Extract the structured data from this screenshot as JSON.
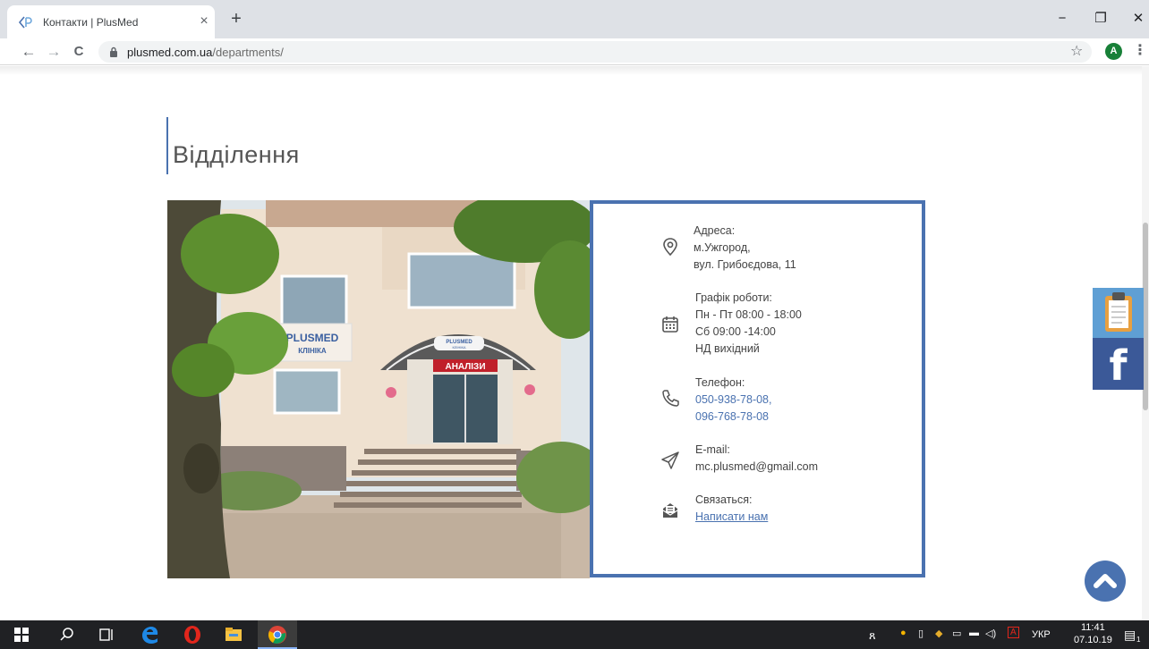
{
  "browser": {
    "tab_title": "Контакти | PlusMed",
    "tab_close": "×",
    "new_tab": "+",
    "win_min": "−",
    "win_restore": "❐",
    "win_close": "✕",
    "back": "←",
    "forward": "→",
    "reload": "C",
    "url_domain": "plusmed.com.ua",
    "url_path": "/departments/",
    "star": "☆",
    "avatar_letter": "A",
    "menu": "⋮"
  },
  "page": {
    "title": "Відділення",
    "photo_sign": "PLUSMED",
    "photo_sign_sub": "КЛІНІКА",
    "photo_door_sign": "PLUSMED",
    "photo_door_sub": "КЛІНІКА",
    "photo_red_sign": "АНАЛІЗИ",
    "contacts": {
      "address_label": "Адреса:",
      "address_line1": "м.Ужгород,",
      "address_line2": "вул. Грибоєдова, 11",
      "schedule_label": "Графік роботи:",
      "schedule_line1": "Пн - Пт 08:00 - 18:00",
      "schedule_line2": "Сб 09:00 -14:00",
      "schedule_line3": "НД вихідний",
      "phone_label": "Телефон:",
      "phone1": "050-938-78-08,",
      "phone2": "096-768-78-08",
      "email_label": "E-mail:",
      "email": "mc.plusmed@gmail.com",
      "contact_label": "Связаться:",
      "contact_link": "Написати нам"
    },
    "facebook_letter": "f"
  },
  "taskbar": {
    "lang": "УКР",
    "time": "11:41",
    "date": "07.10.19",
    "notif_count": "1"
  },
  "colors": {
    "accent": "#4a72b0",
    "facebook": "#3b5998",
    "notes_btn": "#5f9fd4"
  },
  "icons": [
    "pin-icon",
    "calendar-icon",
    "phone-icon",
    "send-icon",
    "mail-icon",
    "clipboard-icon",
    "facebook-icon",
    "chevron-up-icon"
  ]
}
